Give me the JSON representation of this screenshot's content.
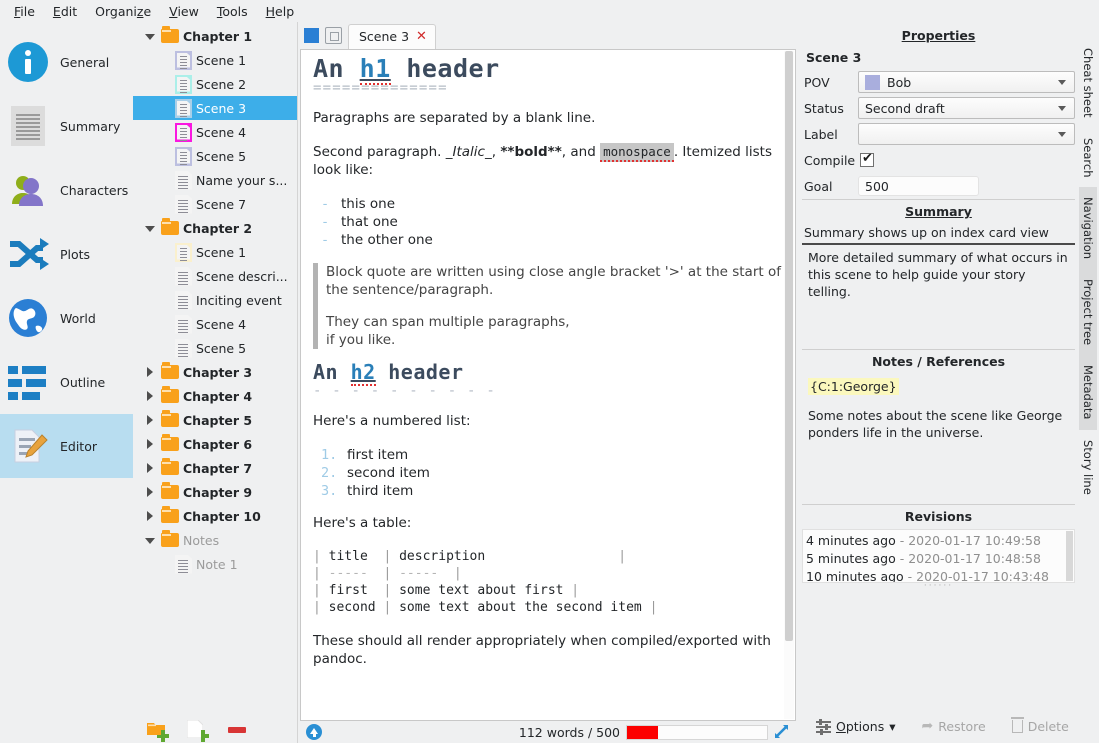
{
  "menubar": {
    "items": [
      "File",
      "Edit",
      "Organize",
      "View",
      "Tools",
      "Help"
    ]
  },
  "viewbar": {
    "items": [
      {
        "label": "General",
        "icon": "info-icon",
        "active": false
      },
      {
        "label": "Summary",
        "icon": "document-icon",
        "active": false
      },
      {
        "label": "Characters",
        "icon": "people-icon",
        "active": false
      },
      {
        "label": "Plots",
        "icon": "shuffle-icon",
        "active": false
      },
      {
        "label": "World",
        "icon": "globe-icon",
        "active": false
      },
      {
        "label": "Outline",
        "icon": "list-icon",
        "active": false
      },
      {
        "label": "Editor",
        "icon": "edit-icon",
        "active": true
      }
    ]
  },
  "tree": {
    "items": [
      {
        "label": "Chapter 1",
        "type": "folder",
        "depth": 0,
        "twist": "open",
        "bold": true,
        "selected": false,
        "muted": false,
        "color": ""
      },
      {
        "label": "Scene 1",
        "type": "doc",
        "depth": 1,
        "twist": "none",
        "bold": false,
        "selected": false,
        "muted": false,
        "color": "#bcbfe0"
      },
      {
        "label": "Scene 2",
        "type": "doc",
        "depth": 1,
        "twist": "none",
        "bold": false,
        "selected": false,
        "muted": false,
        "color": "#abefe9"
      },
      {
        "label": "Scene 3",
        "type": "doc",
        "depth": 1,
        "twist": "none",
        "bold": false,
        "selected": true,
        "muted": false,
        "color": "#a9cfe8"
      },
      {
        "label": "Scene 4",
        "type": "doc",
        "depth": 1,
        "twist": "none",
        "bold": false,
        "selected": false,
        "muted": false,
        "color": "#fa17e0"
      },
      {
        "label": "Scene 5",
        "type": "doc",
        "depth": 1,
        "twist": "none",
        "bold": false,
        "selected": false,
        "muted": false,
        "color": "#bcbfe0"
      },
      {
        "label": "Name your s...",
        "type": "doc",
        "depth": 1,
        "twist": "none",
        "bold": false,
        "selected": false,
        "muted": false,
        "color": ""
      },
      {
        "label": "Scene 7",
        "type": "doc",
        "depth": 1,
        "twist": "none",
        "bold": false,
        "selected": false,
        "muted": false,
        "color": ""
      },
      {
        "label": "Chapter 2",
        "type": "folder",
        "depth": 0,
        "twist": "open",
        "bold": true,
        "selected": false,
        "muted": false,
        "color": ""
      },
      {
        "label": "Scene 1",
        "type": "doc",
        "depth": 1,
        "twist": "none",
        "bold": false,
        "selected": false,
        "muted": false,
        "color": "#faf0cd"
      },
      {
        "label": "Scene descri...",
        "type": "doc",
        "depth": 1,
        "twist": "none",
        "bold": false,
        "selected": false,
        "muted": false,
        "color": ""
      },
      {
        "label": "Inciting event",
        "type": "doc",
        "depth": 1,
        "twist": "none",
        "bold": false,
        "selected": false,
        "muted": false,
        "color": ""
      },
      {
        "label": "Scene 4",
        "type": "doc",
        "depth": 1,
        "twist": "none",
        "bold": false,
        "selected": false,
        "muted": false,
        "color": ""
      },
      {
        "label": "Scene 5",
        "type": "doc",
        "depth": 1,
        "twist": "none",
        "bold": false,
        "selected": false,
        "muted": false,
        "color": ""
      },
      {
        "label": "Chapter 3",
        "type": "folder",
        "depth": 0,
        "twist": "closed",
        "bold": true,
        "selected": false,
        "muted": false,
        "color": ""
      },
      {
        "label": "Chapter 4",
        "type": "folder",
        "depth": 0,
        "twist": "closed",
        "bold": true,
        "selected": false,
        "muted": false,
        "color": ""
      },
      {
        "label": "Chapter 5",
        "type": "folder",
        "depth": 0,
        "twist": "closed",
        "bold": true,
        "selected": false,
        "muted": false,
        "color": ""
      },
      {
        "label": "Chapter 6",
        "type": "folder",
        "depth": 0,
        "twist": "closed",
        "bold": true,
        "selected": false,
        "muted": false,
        "color": ""
      },
      {
        "label": "Chapter 7",
        "type": "folder",
        "depth": 0,
        "twist": "closed",
        "bold": true,
        "selected": false,
        "muted": false,
        "color": ""
      },
      {
        "label": "Chapter 9",
        "type": "folder",
        "depth": 0,
        "twist": "closed",
        "bold": true,
        "selected": false,
        "muted": false,
        "color": ""
      },
      {
        "label": "Chapter 10",
        "type": "folder",
        "depth": 0,
        "twist": "closed",
        "bold": true,
        "selected": false,
        "muted": false,
        "color": ""
      },
      {
        "label": "Notes",
        "type": "folder",
        "depth": 0,
        "twist": "open",
        "bold": false,
        "selected": false,
        "muted": true,
        "color": ""
      },
      {
        "label": "Note 1",
        "type": "doc",
        "depth": 1,
        "twist": "none",
        "bold": false,
        "selected": false,
        "muted": true,
        "color": ""
      }
    ],
    "tools": [
      {
        "name": "add-folder-button",
        "title": "Add folder"
      },
      {
        "name": "add-text-button",
        "title": "Add text"
      },
      {
        "name": "remove-item-button",
        "title": "Remove"
      }
    ]
  },
  "editor": {
    "tab_label": "Scene 3",
    "tab_close": "✕",
    "h1_pre": "An ",
    "h1_word": "h1",
    "h1_post": " header",
    "h1_rule": "==============",
    "p1": "Paragraphs are separated by a blank line.",
    "p2_a": "Second paragraph. ",
    "p2_italic": "_Italic_",
    "p2_b": ", ",
    "p2_bold": "**bold**",
    "p2_c": ", and ",
    "p2_mono": "monospace",
    "p2_d": ". Itemized lists look like:",
    "bullets": [
      "this one",
      "that one",
      "the other one"
    ],
    "quote1": "Block quote are written using close angle bracket '>' at the start of the sentence/paragraph.",
    "quote2": "They can span multiple paragraphs,\nif you like.",
    "h2_pre": "An ",
    "h2_word": "h2",
    "h2_post": " header",
    "h2_rule": "- - - - - - - - - -",
    "p3": "Here's a numbered list:",
    "numbers": [
      "first item",
      "second item",
      "third item"
    ],
    "p4": "Here's a table:",
    "table_lines": [
      "| title  | description                 |",
      "| -----  | -----  |",
      "| first  | some text about first |",
      "| second | some text about the second item |"
    ],
    "p5": "These should all render appropriately when compiled/exported with pandoc."
  },
  "statusbar": {
    "word_count": "112 words / 500",
    "progress_percent": 22,
    "up_icon": "scroll-up-icon",
    "expand_icon": "fullscreen-icon"
  },
  "properties": {
    "title": "Properties",
    "scene_name": "Scene 3",
    "fields": {
      "pov_label": "POV",
      "pov_value": "Bob",
      "pov_color": "#a9aedd",
      "status_label": "Status",
      "status_value": "Second draft",
      "label_label": "Label",
      "label_value": "",
      "compile_label": "Compile",
      "compile_checked": true,
      "goal_label": "Goal",
      "goal_value": "500"
    },
    "summary": {
      "heading": "Summary",
      "one_line": "Summary shows up on index card view",
      "full": "More detailed summary of what occurs in this scene to help guide your story telling."
    },
    "notes": {
      "heading": "Notes / References",
      "reference": "{C:1:George}",
      "text": "Some notes about the scene like George ponders life in the universe."
    },
    "revisions": {
      "heading": "Revisions",
      "rows": [
        {
          "ago": "4 minutes ago",
          "stamp": "- 2020-01-17 10:49:58"
        },
        {
          "ago": "5 minutes ago",
          "stamp": "- 2020-01-17 10:48:58"
        },
        {
          "ago": "10 minutes ago",
          "stamp": "- 2020-01-17 10:43:48"
        }
      ]
    },
    "tools": {
      "options": "Options",
      "restore": "Restore",
      "delete": "Delete"
    }
  },
  "vtabs": {
    "items": [
      {
        "label": "Cheat sheet",
        "shaded": false
      },
      {
        "label": "Search",
        "shaded": false
      },
      {
        "label": "Navigation",
        "shaded": true
      },
      {
        "label": "Project tree",
        "shaded": true
      },
      {
        "label": "Metadata",
        "shaded": true
      },
      {
        "label": "Story line",
        "shaded": false
      }
    ]
  }
}
